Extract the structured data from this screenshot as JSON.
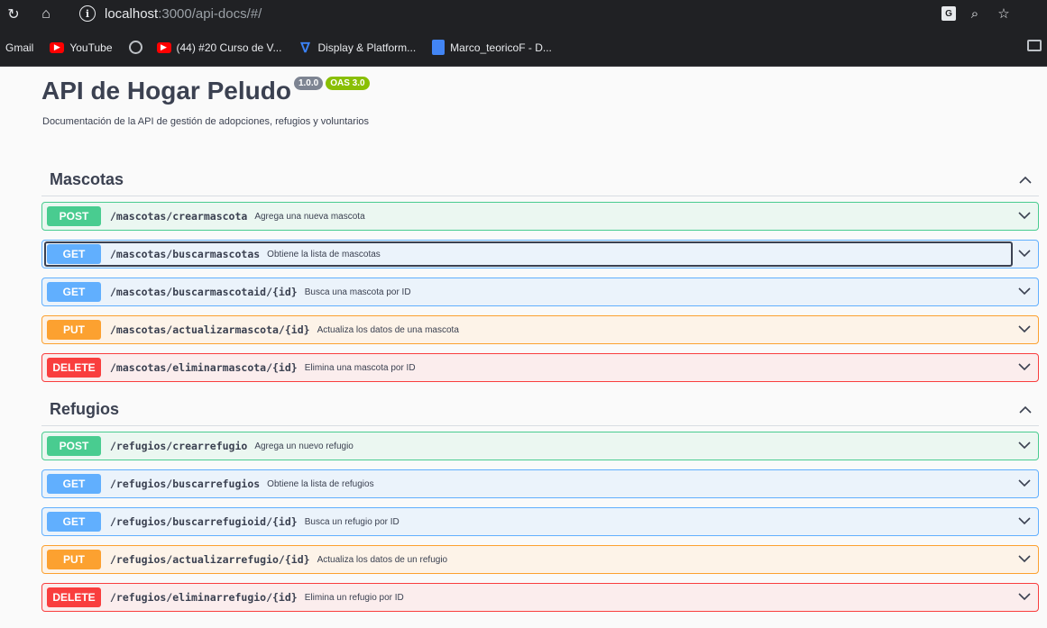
{
  "browser": {
    "url_host": "localhost",
    "url_rest": ":3000/api-docs/#/",
    "bookmarks": [
      {
        "label": "Gmail",
        "icon": "none"
      },
      {
        "label": "YouTube",
        "icon": "youtube-icon"
      },
      {
        "label": "",
        "icon": "globe-icon"
      },
      {
        "label": "(44) #20 Curso de V...",
        "icon": "youtube-icon"
      },
      {
        "label": "Display & Platform...",
        "icon": "vscode-icon"
      },
      {
        "label": "Marco_teoricoF - D...",
        "icon": "docs-icon"
      }
    ]
  },
  "api": {
    "title": "API de Hogar Peludo",
    "version": "1.0.0",
    "oas": "OAS 3.0",
    "description": "Documentación de la API de gestión de adopciones, refugios y voluntarios"
  },
  "sections": [
    {
      "name": "Mascotas",
      "ops": [
        {
          "method": "POST",
          "path": "/mascotas/crearmascota",
          "summary": "Agrega una nueva mascota"
        },
        {
          "method": "GET",
          "path": "/mascotas/buscarmascotas",
          "summary": "Obtiene la lista de mascotas"
        },
        {
          "method": "GET",
          "path": "/mascotas/buscarmascotaid/{id}",
          "summary": "Busca una mascota por ID"
        },
        {
          "method": "PUT",
          "path": "/mascotas/actualizarmascota/{id}",
          "summary": "Actualiza los datos de una mascota"
        },
        {
          "method": "DELETE",
          "path": "/mascotas/eliminarmascota/{id}",
          "summary": "Elimina una mascota por ID"
        }
      ]
    },
    {
      "name": "Refugios",
      "ops": [
        {
          "method": "POST",
          "path": "/refugios/crearrefugio",
          "summary": "Agrega un nuevo refugio"
        },
        {
          "method": "GET",
          "path": "/refugios/buscarrefugios",
          "summary": "Obtiene la lista de refugios"
        },
        {
          "method": "GET",
          "path": "/refugios/buscarrefugioid/{id}",
          "summary": "Busca un refugio por ID"
        },
        {
          "method": "PUT",
          "path": "/refugios/actualizarrefugio/{id}",
          "summary": "Actualiza los datos de un refugio"
        },
        {
          "method": "DELETE",
          "path": "/refugios/eliminarrefugio/{id}",
          "summary": "Elimina un refugio por ID"
        }
      ]
    }
  ],
  "colors": {
    "post": "#49cc90",
    "get": "#61affe",
    "put": "#fca130",
    "delete": "#f93e3e",
    "text": "#3b4151"
  }
}
